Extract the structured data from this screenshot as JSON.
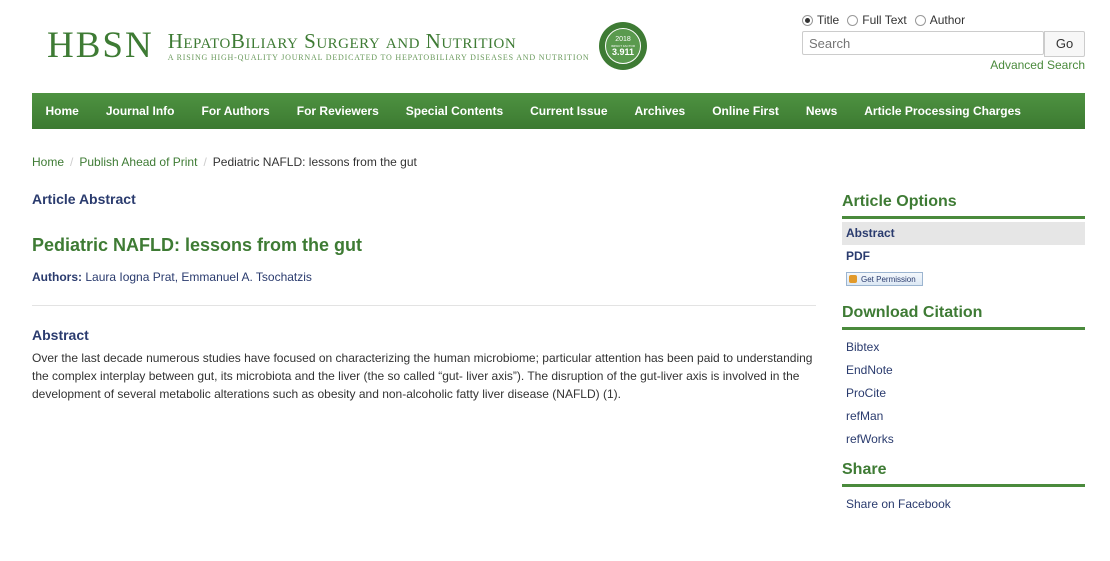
{
  "header": {
    "logo_abbr": "HBSN",
    "logo_title": "HepatoBiliary Surgery and Nutrition",
    "logo_tagline": "A RISING HIGH-QUALITY JOURNAL DEDICATED TO HEPATOBILIARY DISEASES AND NUTRITION",
    "seal_year": "2018",
    "seal_label": "IMPACT FACTOR",
    "seal_value": "3.911"
  },
  "search": {
    "options": [
      "Title",
      "Full Text",
      "Author"
    ],
    "selected": "Title",
    "placeholder": "Search",
    "go_label": "Go",
    "advanced_label": "Advanced Search"
  },
  "nav": [
    "Home",
    "Journal Info",
    "For Authors",
    "For Reviewers",
    "Special Contents",
    "Current Issue",
    "Archives",
    "Online First",
    "News",
    "Article Processing Charges"
  ],
  "breadcrumb": [
    "Home",
    "Publish Ahead of Print",
    "Pediatric NAFLD: lessons from the gut"
  ],
  "article": {
    "section_label": "Article Abstract",
    "title": "Pediatric NAFLD: lessons from the gut",
    "authors_label": "Authors:",
    "authors": "Laura Iogna Prat, Emmanuel A. Tsochatzis",
    "abstract_heading": "Abstract",
    "abstract_text": "Over the last decade numerous studies have focused on characterizing the human microbiome; particular attention has been paid to understanding the complex interplay between gut, its microbiota and the liver (the so called “gut- liver axis”). The disruption of the gut-liver axis is involved in the development of several metabolic alterations such as obesity and non-alcoholic fatty liver disease (NAFLD) (1)."
  },
  "sidebar": {
    "options_heading": "Article Options",
    "options": [
      "Abstract",
      "PDF"
    ],
    "permission_label": "Get Permission",
    "citation_heading": "Download Citation",
    "citations": [
      "Bibtex",
      "EndNote",
      "ProCite",
      "refMan",
      "refWorks"
    ],
    "share_heading": "Share",
    "share_link": "Share on Facebook"
  },
  "colors": {
    "brand_green": "#3e7b34",
    "nav_green": "#4a8a3c",
    "link_navy": "#2a3b6e"
  }
}
